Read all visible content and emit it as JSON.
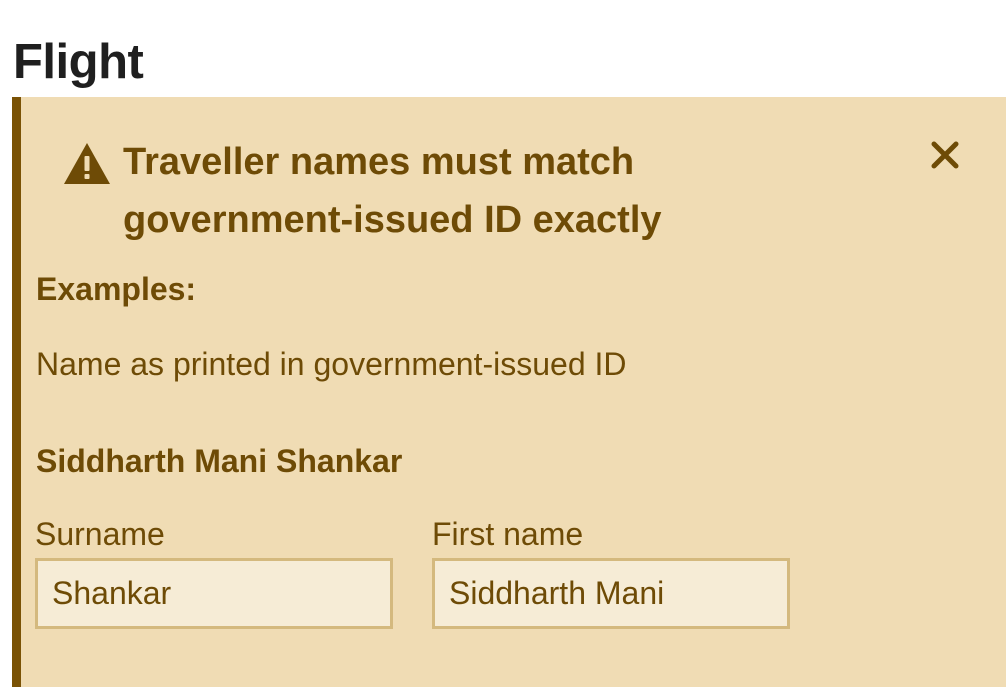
{
  "page": {
    "title": "Flight"
  },
  "alert": {
    "title": "Traveller names must match government-issued ID exactly",
    "icon": "warning-icon",
    "close_icon": "close-icon",
    "examples_label": "Examples:",
    "example_description": "Name as printed in government-issued ID",
    "example_name": "Siddharth Mani Shankar",
    "fields": {
      "surname": {
        "label": "Surname",
        "value": "Shankar"
      },
      "first_name": {
        "label": "First name",
        "value": "Siddharth Mani"
      }
    },
    "colors": {
      "background": "#f0dcb4",
      "accent": "#7a5205",
      "text": "#6e4b06",
      "input_background": "#f6ecd6",
      "input_border": "#d4b97e"
    }
  }
}
